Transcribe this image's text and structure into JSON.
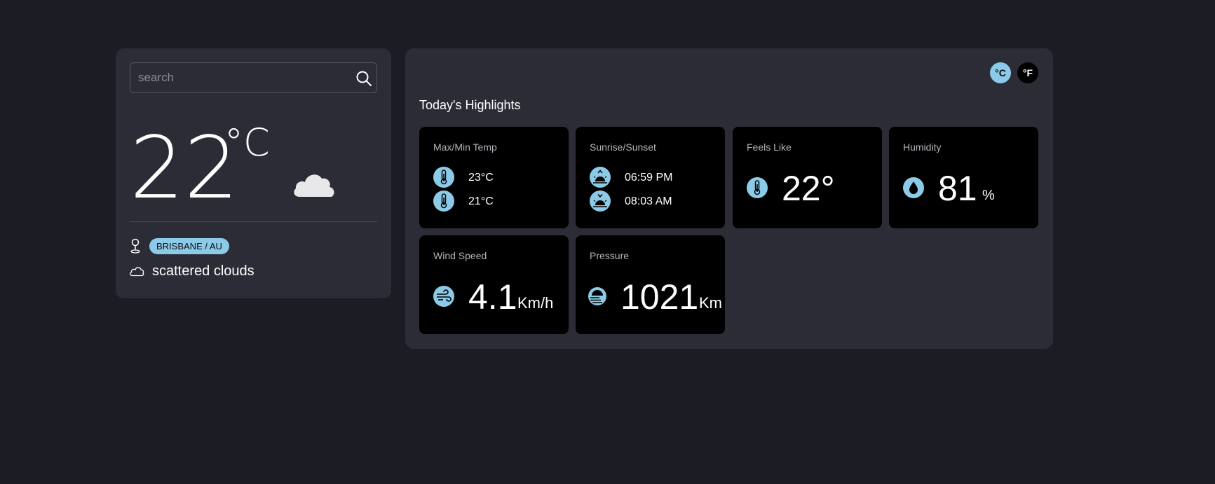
{
  "search": {
    "placeholder": "search"
  },
  "current": {
    "temperature": "22",
    "unit": "°C",
    "location": "BRISBANE / AU",
    "description": "scattered clouds"
  },
  "units": {
    "celsius": "°C",
    "fahrenheit": "°F"
  },
  "highlights": {
    "title": "Today's Highlights",
    "max_min": {
      "label": "Max/Min Temp",
      "max": "23°C",
      "min": "21°C"
    },
    "sun": {
      "label": "Sunrise/Sunset",
      "sunrise": "06:59 PM",
      "sunset": "08:03 AM"
    },
    "feels_like": {
      "label": "Feels Like",
      "value": "22°"
    },
    "humidity": {
      "label": "Humidity",
      "value": "81",
      "unit": "%"
    },
    "wind": {
      "label": "Wind Speed",
      "value": "4.1",
      "unit": "Km/h"
    },
    "pressure": {
      "label": "Pressure",
      "value": "1021",
      "unit": "Km"
    }
  },
  "colors": {
    "background": "#1c1c24",
    "panel": "#2c2c36",
    "card": "#000000",
    "accent": "#8ccbe8"
  }
}
